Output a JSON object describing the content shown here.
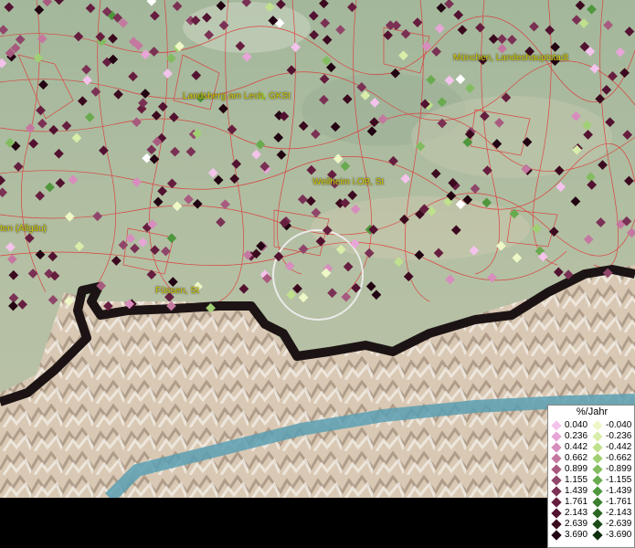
{
  "map": {
    "places": [
      {
        "name": "München, Landeshauptstadt",
        "label": "München, Landeshauptstadt"
      },
      {
        "name": "Landsberg am Lech",
        "label": "Landsberg am Lech, GKSt"
      },
      {
        "name": "Weilheim",
        "label": "Weilheim i.OB, St"
      },
      {
        "name": "Kempten",
        "label": "ten (Allgäu)"
      },
      {
        "name": "Füssen",
        "label": "Füssen, St"
      }
    ],
    "colors": {
      "terrain_low": "#a9bd9f",
      "terrain_mid": "#b7c2a6",
      "mountains": "#d8c6b0",
      "border": "#1c1414",
      "river": "#5a9fb3",
      "admin_lines": "#e03030",
      "label": "#d8d000"
    },
    "focus_circle": "selection-ring"
  },
  "legend": {
    "title": "%/Jahr",
    "positive": [
      {
        "value": "0.040",
        "color": "#f3c3ec"
      },
      {
        "value": "0.236",
        "color": "#e7a6d7"
      },
      {
        "value": "0.442",
        "color": "#d78dbd"
      },
      {
        "value": "0.662",
        "color": "#c4789f"
      },
      {
        "value": "0.899",
        "color": "#a85a7f"
      },
      {
        "value": "1.155",
        "color": "#90466a"
      },
      {
        "value": "1.439",
        "color": "#7a3154"
      },
      {
        "value": "1.761",
        "color": "#661e3f"
      },
      {
        "value": "2.143",
        "color": "#521230"
      },
      {
        "value": "2.639",
        "color": "#3c0a1f"
      },
      {
        "value": "3.690",
        "color": "#220412"
      }
    ],
    "negative": [
      {
        "value": "-0.040",
        "color": "#eef7c6"
      },
      {
        "value": "-0.236",
        "color": "#d9edaa"
      },
      {
        "value": "-0.442",
        "color": "#bfe08c"
      },
      {
        "value": "-0.662",
        "color": "#a1d074"
      },
      {
        "value": "-0.899",
        "color": "#83bc60"
      },
      {
        "value": "-1.155",
        "color": "#69aa4f"
      },
      {
        "value": "-1.439",
        "color": "#4f963d"
      },
      {
        "value": "-1.761",
        "color": "#3b7f2e"
      },
      {
        "value": "-2.143",
        "color": "#2a6622"
      },
      {
        "value": "-2.639",
        "color": "#1b4c17"
      },
      {
        "value": "-3.690",
        "color": "#0e2f0c"
      }
    ]
  }
}
